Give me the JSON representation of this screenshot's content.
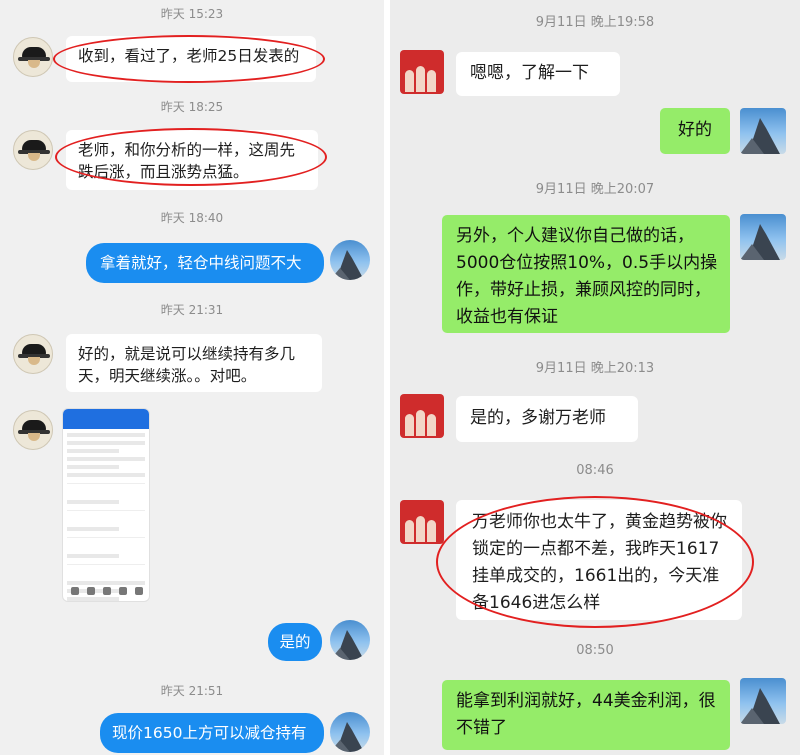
{
  "left": {
    "timestamps": [
      "昨天 15:23",
      "昨天 18:25",
      "昨天 18:40",
      "昨天 21:31",
      "昨天 21:51"
    ],
    "messages": [
      {
        "side": "in",
        "text": "收到，看过了，老师25日发表的"
      },
      {
        "side": "in",
        "text": "老师，和你分析的一样，这周先跌后涨，而且涨势点猛。"
      },
      {
        "side": "out",
        "text": "拿着就好，轻仓中线问题不大"
      },
      {
        "side": "in",
        "text": "好的，就是说可以继续持有多几天，明天继续涨。。对吧。"
      },
      {
        "side": "in",
        "type": "image",
        "icon": "trading-app-screenshot"
      },
      {
        "side": "out",
        "text": "是的"
      },
      {
        "side": "out",
        "text": "现价1650上方可以减仓持有"
      }
    ]
  },
  "right": {
    "timestamps": [
      "9月11日 晚上19:58",
      "9月11日 晚上20:07",
      "9月11日 晚上20:13",
      "08:46",
      "08:50"
    ],
    "messages": [
      {
        "side": "in",
        "text": "嗯嗯，了解一下"
      },
      {
        "side": "out",
        "text": "好的"
      },
      {
        "side": "out",
        "text": "另外，个人建议你自己做的话，5000仓位按照10%，0.5手以内操作，带好止损，兼顾风控的同时，收益也有保证"
      },
      {
        "side": "in",
        "text": "是的，多谢万老师"
      },
      {
        "side": "in",
        "text": "万老师你也太牛了，黄金趋势被你锁定的一点都不差，我昨天1617挂单成交的，1661出的，今天准备1646进怎么样"
      },
      {
        "side": "out",
        "text": "能拿到利润就好，44美金利润，很不错了"
      }
    ]
  },
  "colors": {
    "blue_bubble": "#1a8df0",
    "green_bubble": "#95ec69",
    "highlight_ring": "#e22020"
  }
}
